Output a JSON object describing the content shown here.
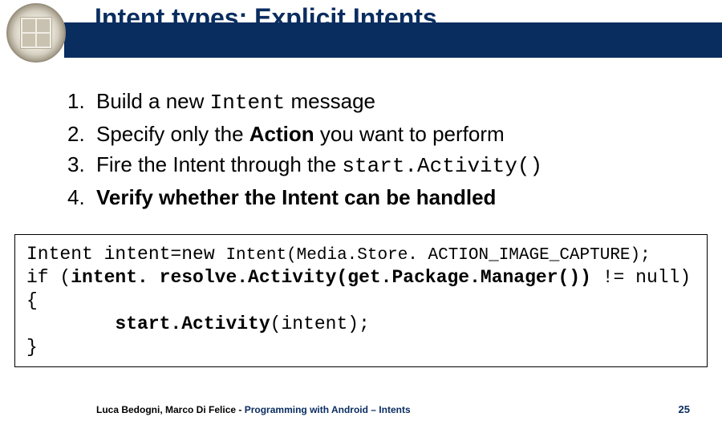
{
  "title": "Intent types: Explicit Intents",
  "list": {
    "items": [
      {
        "num": "1.",
        "html": "Build a new <span class='mono'>Intent</span> message"
      },
      {
        "num": "2.",
        "html": "Specify only the <b>Action</b> you want to perform"
      },
      {
        "num": "3.",
        "html": "Fire the Intent through the <span class='mono'>start.Activity()</span>"
      },
      {
        "num": "4.",
        "html": "<b>Verify whether the Intent can be handled</b>"
      }
    ]
  },
  "code": {
    "lines": [
      "Intent intent=new <span style='font-size:21px'>Intent(Media.Store. ACTION_IMAGE_CAPTURE);</span>",
      "if (<b>intent. resolve.Activity(get.Package.Manager())</b> != null) {",
      "&nbsp;&nbsp;&nbsp;&nbsp;&nbsp;&nbsp;&nbsp;&nbsp;<b>start.Activity</b>(intent);",
      "}"
    ]
  },
  "footer": {
    "authors": "Luca Bedogni, Marco Di Felice",
    "dash": " - ",
    "course": "Programming with Android – Intents",
    "page": "25"
  }
}
